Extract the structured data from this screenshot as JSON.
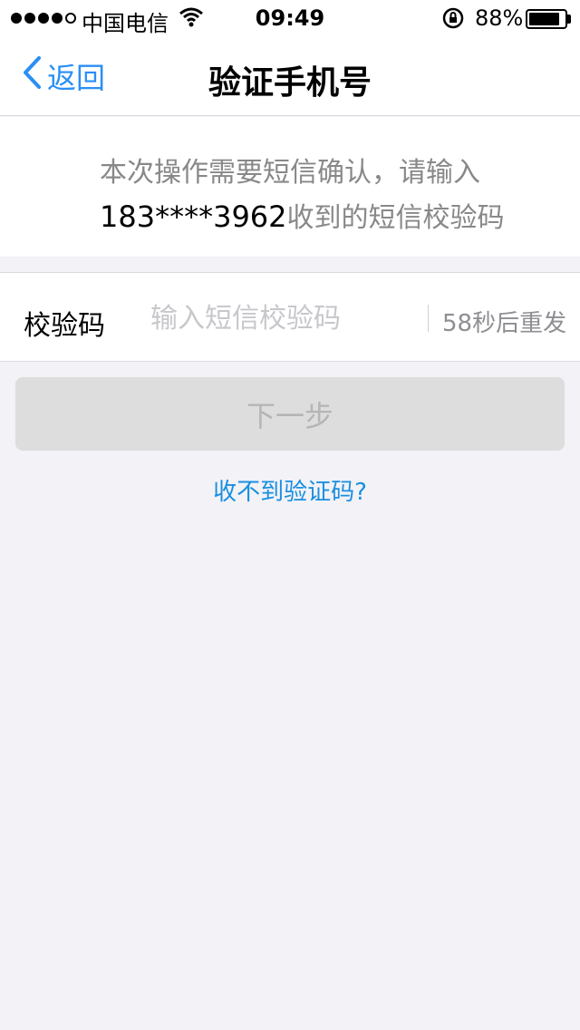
{
  "status_bar": {
    "carrier": "中国电信",
    "time": "09:49",
    "battery_percent": "88%",
    "battery_level": 0.88
  },
  "nav": {
    "back_label": "返回",
    "title": "验证手机号"
  },
  "message": {
    "line1": "本次操作需要短信确认，请输入",
    "phone": "183****3962",
    "line2_suffix": "收到的短信校验码"
  },
  "code_field": {
    "label": "校验码",
    "placeholder": "输入短信校验码",
    "value": "",
    "resend_label": "58秒后重发"
  },
  "next_button": {
    "label": "下一步",
    "enabled": false
  },
  "help_link": "收不到验证码?",
  "colors": {
    "accent": "#2a8ff5",
    "background": "#f2f2f7",
    "disabled_button": "#dddddd"
  }
}
